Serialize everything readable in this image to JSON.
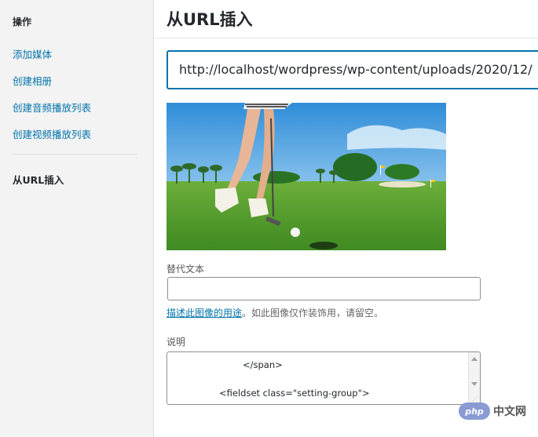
{
  "sidebar": {
    "heading": "操作",
    "items": [
      "添加媒体",
      "创建相册",
      "创建音频播放列表",
      "创建视频播放列表"
    ],
    "active": "从URL插入"
  },
  "main": {
    "title": "从URL插入",
    "url_value": "http://localhost/wordpress/wp-content/uploads/2020/12/",
    "image_alt": "golf photo",
    "alt_label": "替代文本",
    "alt_value": "",
    "help_link": "描述此图像的用途",
    "help_text": "。如此图像仅作装饰用，请留空。",
    "caption_label": "说明",
    "caption_line1": "</span>",
    "caption_line2": "<fieldset class=\"setting-group\">"
  },
  "watermark": {
    "logo": "php",
    "text": "中文网"
  }
}
